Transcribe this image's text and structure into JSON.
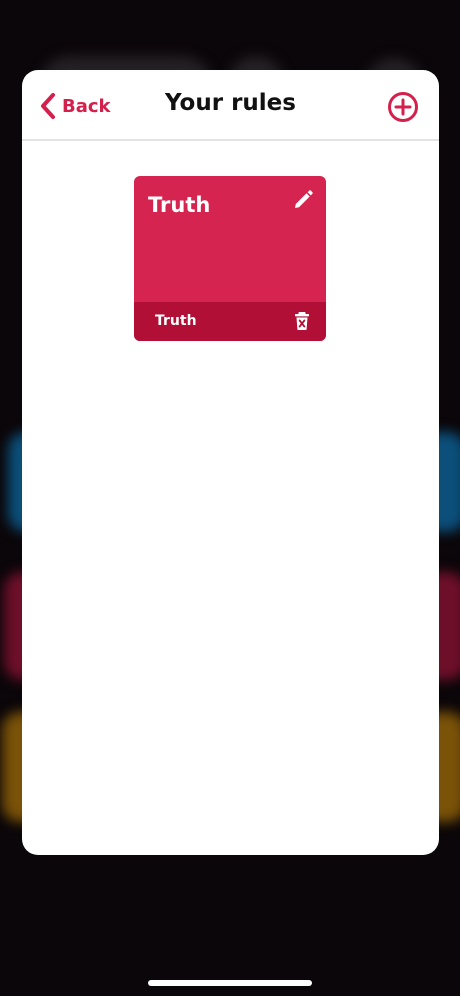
{
  "header": {
    "back_label": "Back",
    "title": "Your rules",
    "back_icon": "chevron-left-icon",
    "add_icon": "plus-circle-icon"
  },
  "rules": [
    {
      "title": "Truth",
      "tag": "Truth",
      "color": "#d62450",
      "footer_color": "#b10f35",
      "edit_icon": "pencil-icon",
      "delete_icon": "trash-icon"
    }
  ],
  "colors": {
    "accent": "#d4204d",
    "background": "#0b0609",
    "sheet": "#ffffff"
  }
}
